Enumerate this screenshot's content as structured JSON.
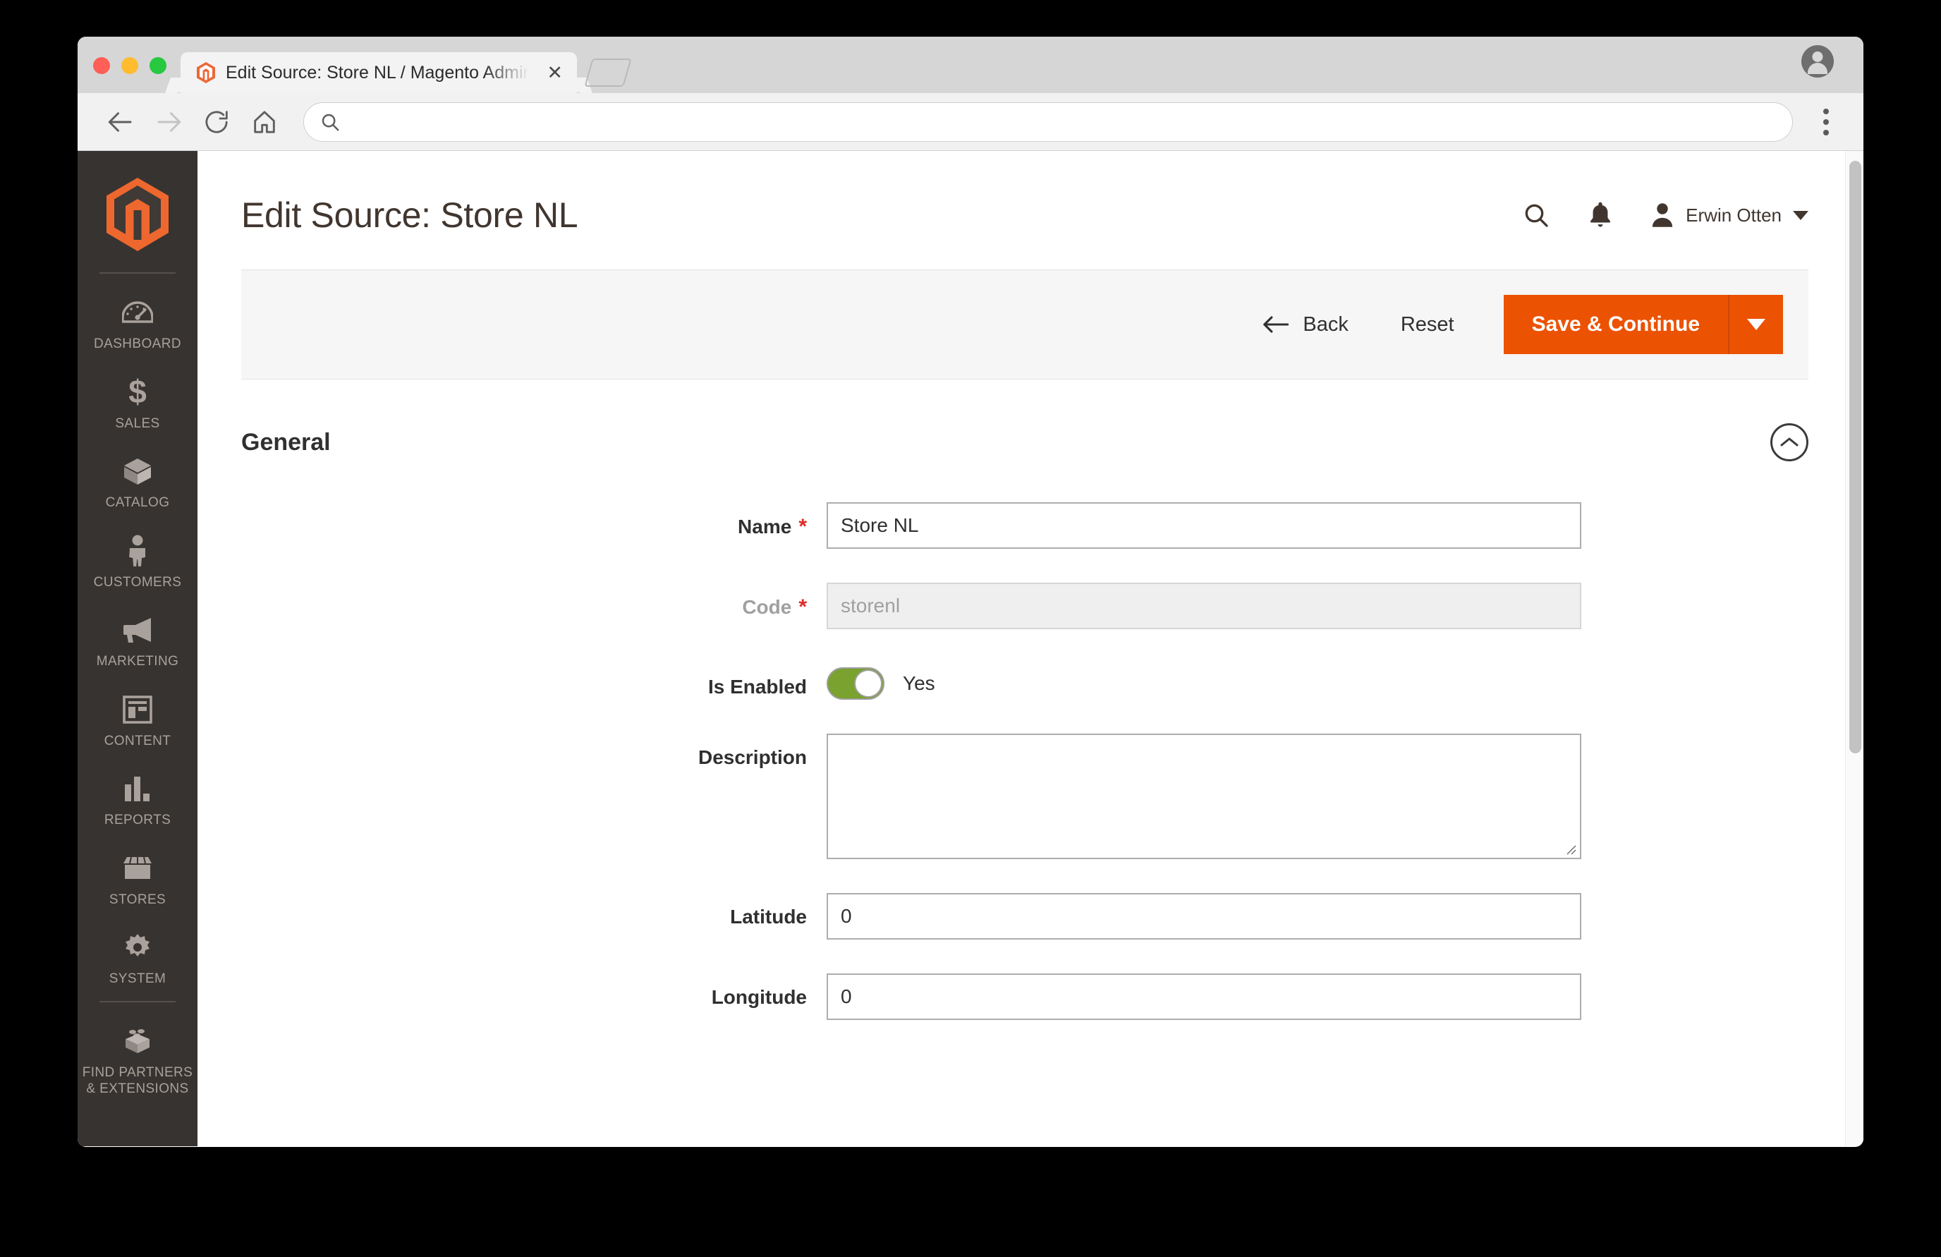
{
  "browser": {
    "tab": {
      "title": "Edit Source: Store NL / Magento Admin",
      "favicon_icon": "magento-favicon",
      "close_icon": "close-icon"
    },
    "new_tab_icon": "new-tab-icon",
    "profile_icon": "profile-avatar-icon",
    "nav": {
      "back_icon": "back-arrow-icon",
      "forward_icon": "forward-arrow-icon",
      "reload_icon": "reload-icon",
      "home_icon": "home-icon",
      "menu_icon": "kebab-menu-icon"
    },
    "address_bar": {
      "value": "",
      "placeholder": "",
      "search_icon": "search-icon"
    }
  },
  "sidebar": {
    "logo_icon": "magento-logo",
    "items": [
      {
        "label": "Dashboard",
        "icon": "dashboard-gauge-icon"
      },
      {
        "label": "Sales",
        "icon": "dollar-sign-icon"
      },
      {
        "label": "Catalog",
        "icon": "box-icon"
      },
      {
        "label": "Customers",
        "icon": "person-icon"
      },
      {
        "label": "Marketing",
        "icon": "megaphone-icon"
      },
      {
        "label": "Content",
        "icon": "layout-icon"
      },
      {
        "label": "Reports",
        "icon": "bar-chart-icon"
      },
      {
        "label": "Stores",
        "icon": "storefront-icon"
      },
      {
        "label": "System",
        "icon": "gear-icon"
      },
      {
        "label": "Find Partners\n& Extensions",
        "icon": "lego-brick-icon"
      }
    ]
  },
  "header": {
    "title": "Edit Source: Store NL",
    "search_icon": "search-icon",
    "notifications_icon": "bell-icon",
    "user": {
      "name": "Erwin Otten",
      "avatar_icon": "user-avatar-icon",
      "caret_icon": "chevron-down-icon"
    }
  },
  "toolbar": {
    "back_label": "Back",
    "back_icon": "arrow-left-icon",
    "reset_label": "Reset",
    "save_label": "Save & Continue",
    "save_menu_icon": "caret-down-icon",
    "accent_color": "#eb5202"
  },
  "section": {
    "title": "General",
    "collapse_icon": "chevron-up-circle-icon"
  },
  "form": {
    "name": {
      "label": "Name",
      "value": "Store NL",
      "required": "*"
    },
    "code": {
      "label": "Code",
      "value": "storenl",
      "required": "*"
    },
    "is_enabled": {
      "label": "Is Enabled",
      "state_text": "Yes",
      "on_color": "#79a22e"
    },
    "description": {
      "label": "Description",
      "value": ""
    },
    "latitude": {
      "label": "Latitude",
      "value": "0"
    },
    "longitude": {
      "label": "Longitude",
      "value": "0"
    }
  }
}
